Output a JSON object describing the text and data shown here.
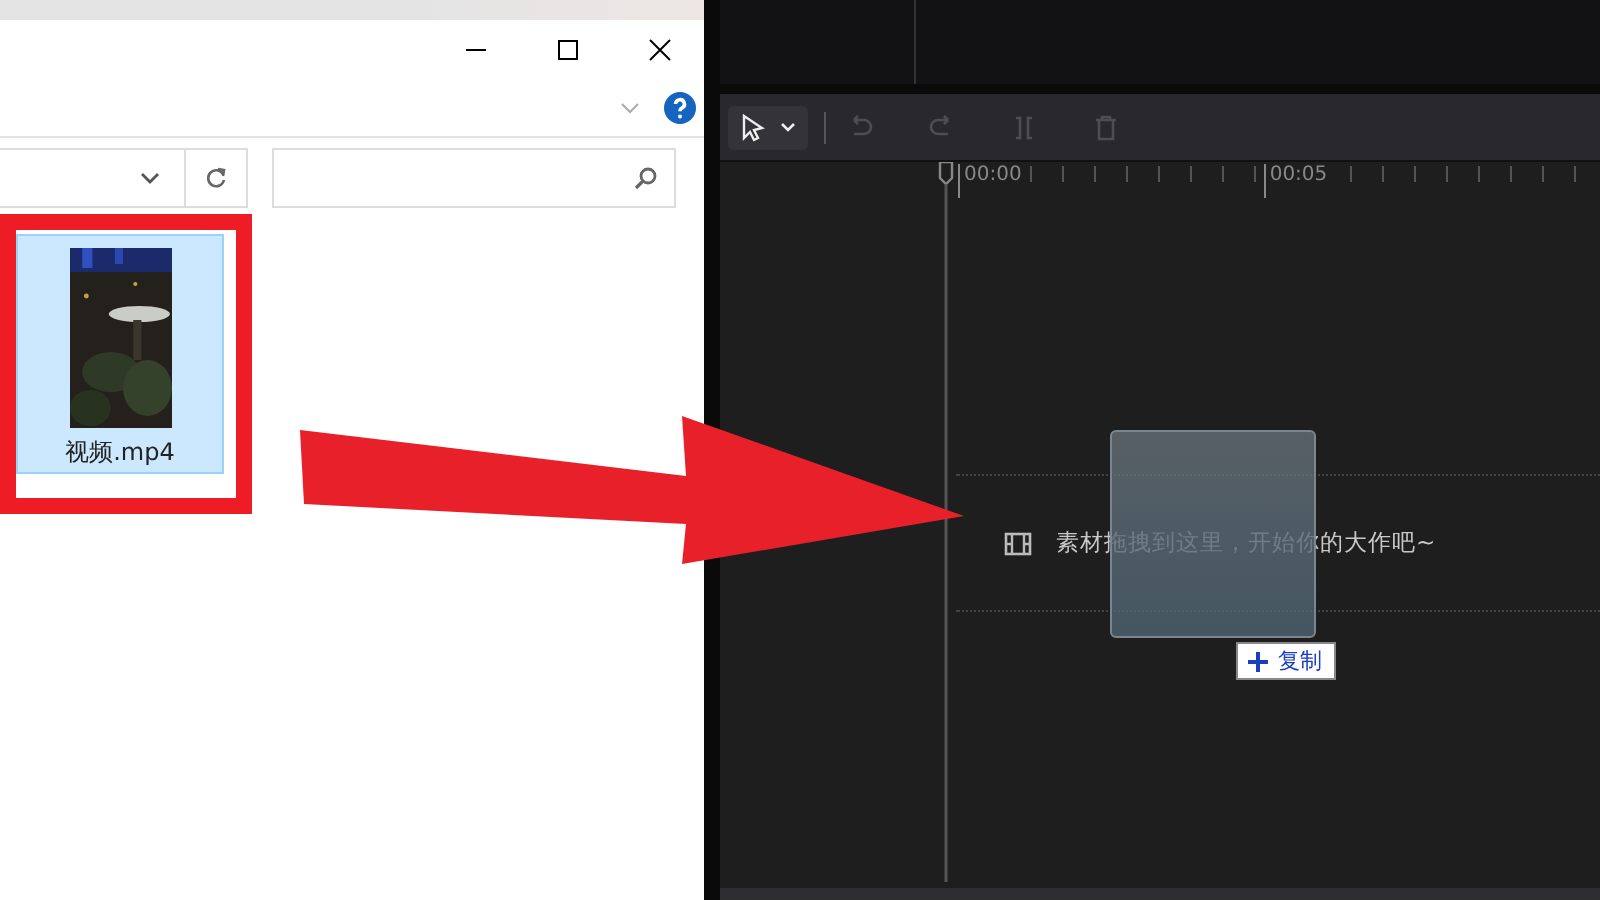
{
  "explorer": {
    "file": {
      "name": "视频.mp4",
      "selected": true
    }
  },
  "editor": {
    "tools": [
      {
        "kind": "select",
        "disabled": false
      },
      {
        "kind": "undo",
        "disabled": true
      },
      {
        "kind": "redo",
        "disabled": true
      },
      {
        "kind": "split",
        "disabled": true
      },
      {
        "kind": "delete",
        "disabled": true
      }
    ],
    "ruler": [
      "00:00",
      "00:05"
    ],
    "track_hint": "素材拖拽到这里，开始你的大作吧~",
    "drag_tooltip": "复制"
  }
}
